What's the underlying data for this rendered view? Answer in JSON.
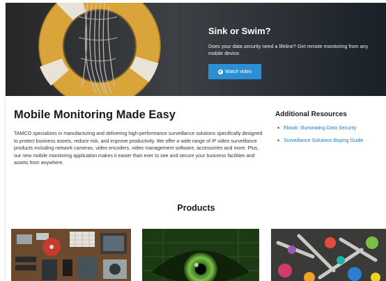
{
  "hero": {
    "title": "Sink or Swim?",
    "text": "Does your data security need a lifeline? Get remote monitoring from any mobile device.",
    "button_label": "Watch video",
    "button_color": "#2b8fd6"
  },
  "main": {
    "title": "Mobile Monitoring Made Easy",
    "body": "TAMCO specializes in manufacturing and delivering high-performance surveillance solutions specifically designed to protect business assets, reduce risk, and improve productivity. We offer a wide range of IP video surveillance products including network cameras, video encoders, video management software, accessories and more. Plus, our new mobile monitoring application makes it easier than ever to see and secure your business facilities and assets from anywhere."
  },
  "sidebar": {
    "title": "Additional Resources",
    "links": [
      {
        "label": "Ebook: Illuminating Data Security"
      },
      {
        "label": "Surveillance Solutions Buying Guide"
      }
    ],
    "link_color": "#1f78c4"
  },
  "products": {
    "title": "Products"
  }
}
